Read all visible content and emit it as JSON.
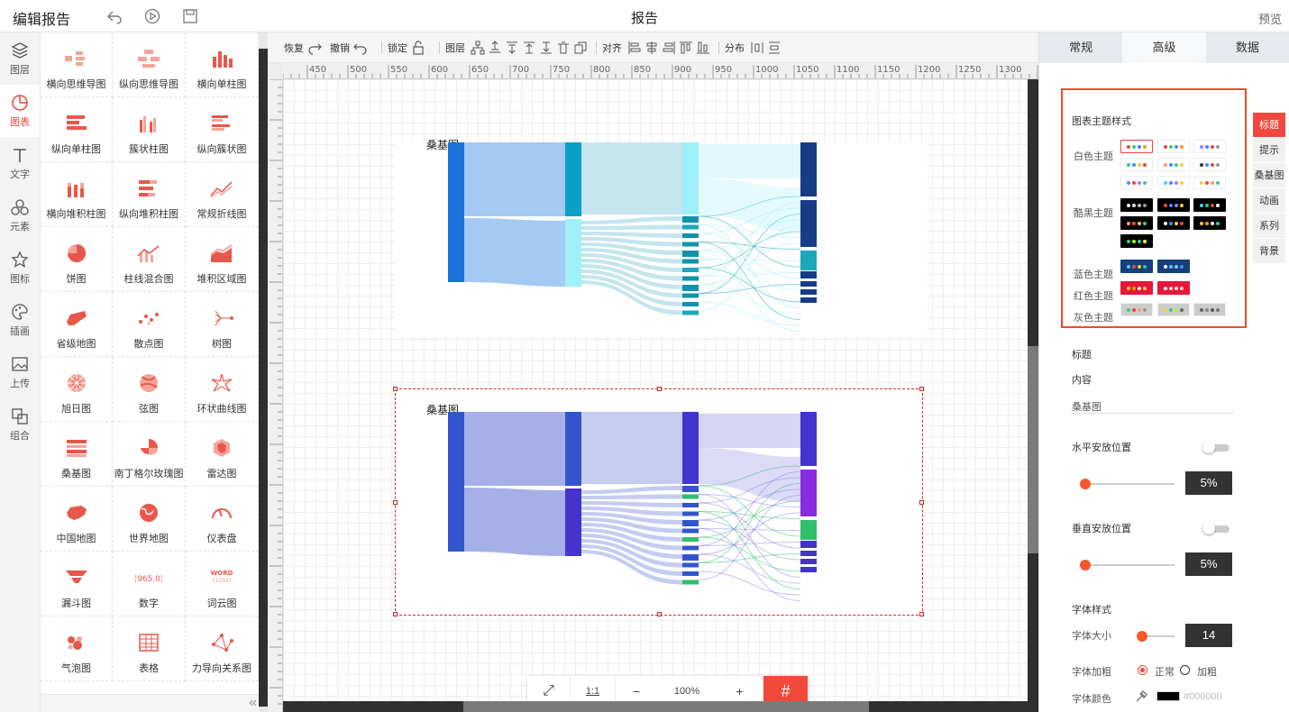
{
  "app": {
    "title": "编辑报告",
    "center_title": "报告",
    "preview": "预览"
  },
  "leftnav": [
    {
      "label": "图层",
      "icon": "layers-icon"
    },
    {
      "label": "图表",
      "icon": "chart-icon"
    },
    {
      "label": "文字",
      "icon": "text-icon"
    },
    {
      "label": "元素",
      "icon": "shapes-icon"
    },
    {
      "label": "图标",
      "icon": "star-icon"
    },
    {
      "label": "插画",
      "icon": "palette-icon"
    },
    {
      "label": "上传",
      "icon": "image-upload-icon"
    },
    {
      "label": "组合",
      "icon": "combine-icon"
    }
  ],
  "palette": [
    "横向思维导图",
    "纵向思维导图",
    "横向单柱图",
    "纵向单柱图",
    "簇状柱图",
    "纵向簇状图",
    "横向堆积柱图",
    "纵向堆积柱图",
    "常规折线图",
    "饼图",
    "柱线混合图",
    "堆积区域图",
    "省级地图",
    "散点图",
    "树图",
    "旭日图",
    "弦图",
    "环状曲线图",
    "桑基图",
    "南丁格尔玫瑰图",
    "雷达图",
    "中国地图",
    "世界地图",
    "仪表盘",
    "漏斗图",
    "数字",
    "词云图",
    "气泡图",
    "表格",
    "力导向关系图"
  ],
  "palette_extra": {
    "number_label": "(965.0)",
    "wordcloud_label_1": "WORD",
    "wordcloud_label_2": "CLOUD"
  },
  "toolbar": {
    "redo": "恢复",
    "undo": "撤销",
    "lock": "锁定",
    "layer": "图层",
    "align": "对齐",
    "distribute": "分布"
  },
  "ruler": {
    "h": [
      "450",
      "500",
      "550",
      "600",
      "650",
      "700",
      "750",
      "800",
      "850",
      "900",
      "950",
      "1000",
      "1050",
      "1100",
      "1150",
      "1200",
      "1250",
      "1300"
    ]
  },
  "charts": [
    {
      "title": "桑基图",
      "theme": "cyan-blue"
    },
    {
      "title": "桑基图",
      "theme": "purple"
    }
  ],
  "zoom": {
    "fit": "⤢",
    "ratio": "1:1",
    "minus": "−",
    "value": "100%",
    "plus": "+",
    "grid": "#"
  },
  "rpanel": {
    "tabs": [
      "常规",
      "高级",
      "数据"
    ],
    "theme_title": "图表主题样式",
    "themes": {
      "white": "白色主题",
      "dark": "酷黑主题",
      "blue": "蓝色主题",
      "red": "红色主题",
      "gray": "灰色主题"
    },
    "sidetabs": [
      "标题",
      "提示",
      "桑基图",
      "动画",
      "系列",
      "背景"
    ],
    "title_label": "标题",
    "content_label": "内容",
    "content_value": "桑基图",
    "hpos_label": "水平安放位置",
    "hpos_value": "5%",
    "hpos_fraction": 0.05,
    "vpos_label": "垂直安放位置",
    "vpos_value": "5%",
    "vpos_fraction": 0.05,
    "font_style_label": "字体样式",
    "font_size_label": "字体大小",
    "font_size_value": "14",
    "font_weight_label": "字体加粗",
    "weight_normal": "正常",
    "weight_bold": "加粗",
    "font_color_label": "字体颜色",
    "font_color_value": "#000000"
  },
  "colors": {
    "accent": "#f0483e",
    "selection": "#d12c2c"
  }
}
